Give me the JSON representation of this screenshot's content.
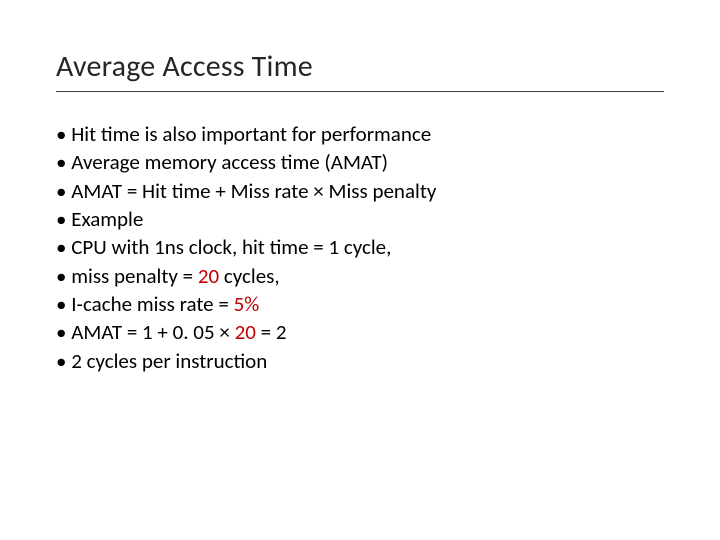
{
  "title": "Average Access Time",
  "lines": {
    "l1": "Hit time is also important for performance",
    "l2": "Average memory access time (AMAT)",
    "l3": "AMAT = Hit time + Miss rate × Miss penalty",
    "l4": "Example",
    "l5": "CPU with 1ns clock, hit time = 1 cycle,",
    "l6a": "miss penalty = ",
    "l6b": "20",
    "l6c": " cycles,",
    "l7a": "I-cache miss rate = ",
    "l7b": "5%",
    "l8a": "AMAT = 1 + 0. 05 × ",
    "l8b": "20",
    "l8c": " = 2",
    "l9": "2 cycles per instruction"
  },
  "bullet": "•"
}
